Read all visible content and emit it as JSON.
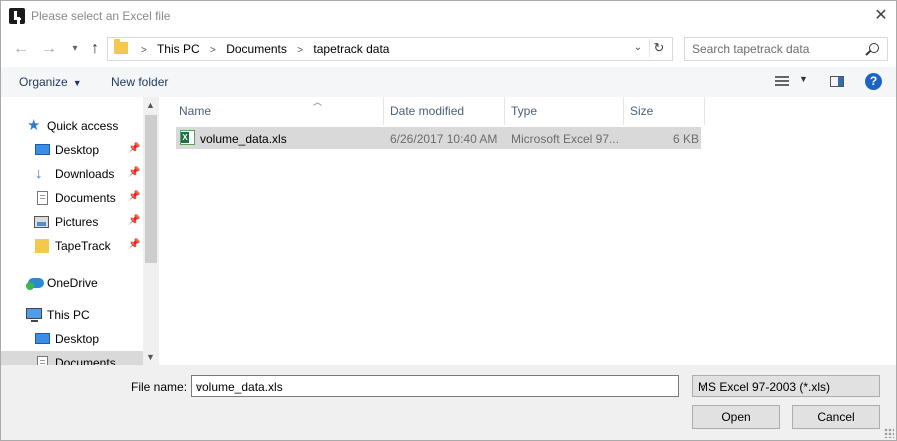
{
  "window": {
    "title": "Please select an Excel file"
  },
  "address": {
    "crumbs": [
      "This PC",
      "Documents",
      "tapetrack data"
    ],
    "separator": ">",
    "dropdown_glyph": "⌄",
    "refresh_glyph": "↻"
  },
  "search": {
    "placeholder": "Search tapetrack data"
  },
  "toolbar": {
    "organize_label": "Organize",
    "new_folder_label": "New folder",
    "help_label": "?"
  },
  "nav_pane": {
    "items": [
      {
        "label": "Quick access",
        "icon": "star-icon"
      },
      {
        "label": "Desktop",
        "icon": "desktop-icon",
        "pinned": true
      },
      {
        "label": "Downloads",
        "icon": "download-arrow-icon",
        "pinned": true
      },
      {
        "label": "Documents",
        "icon": "document-icon",
        "pinned": true
      },
      {
        "label": "Pictures",
        "icon": "pictures-icon",
        "pinned": true
      },
      {
        "label": "TapeTrack",
        "icon": "folder-icon",
        "pinned": true
      },
      {
        "label": "OneDrive",
        "icon": "cloud-icon"
      },
      {
        "label": "This PC",
        "icon": "computer-icon"
      },
      {
        "label": "Desktop",
        "icon": "desktop-icon"
      },
      {
        "label": "Documents",
        "icon": "document-icon",
        "selected": true
      }
    ]
  },
  "file_list": {
    "columns": [
      "Name",
      "Date modified",
      "Type",
      "Size"
    ],
    "rows": [
      {
        "name": "volume_data.xls",
        "date_modified": "6/26/2017 10:40 AM",
        "type": "Microsoft Excel 97...",
        "size": "6 KB",
        "selected": true
      }
    ]
  },
  "bottom": {
    "file_name_label": "File name:",
    "file_name_value": "volume_data.xls",
    "file_type_filter": "MS Excel 97-2003 (*.xls)",
    "open_label": "Open",
    "cancel_label": "Cancel"
  },
  "colors": {
    "accent": "#1c64c4",
    "selection": "#d9d9d9",
    "link_text": "#1e395b"
  }
}
